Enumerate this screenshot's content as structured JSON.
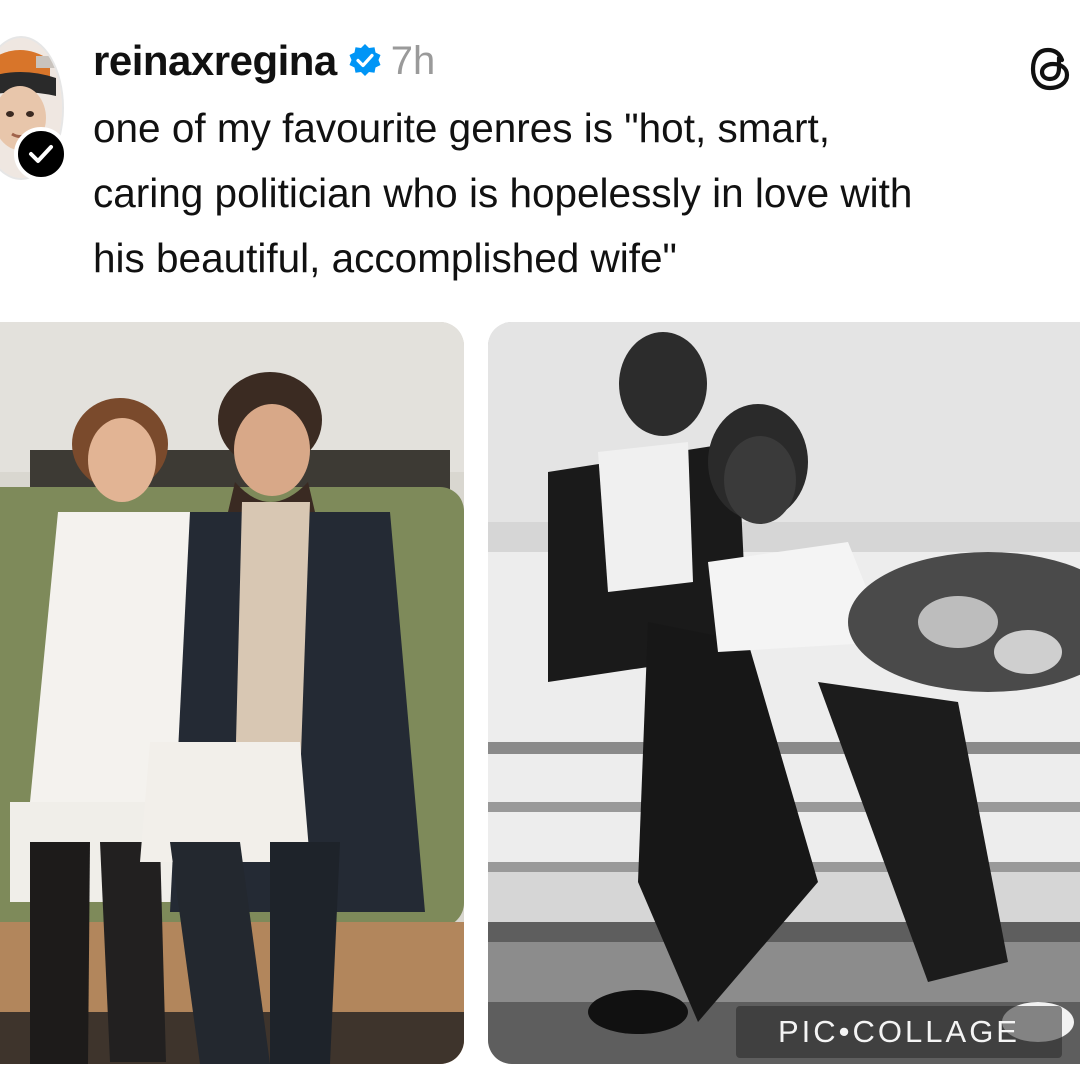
{
  "post": {
    "username": "reinaxregina",
    "timestamp": "7h",
    "text": "one of my favourite genres is \"hot, smart,\ncaring politician who is hopelessly in love with\nhis beautiful, accomplished wife\""
  },
  "icons": {
    "verified": "verified-badge-icon",
    "avatar_badge": "checkmark-icon",
    "app": "threads-logo-icon"
  },
  "photos": {
    "watermark": "PIC•COLLAGE"
  },
  "colors": {
    "verified_blue": "#0095f6",
    "timestamp_grey": "#9a9a9a",
    "text": "#111111"
  }
}
